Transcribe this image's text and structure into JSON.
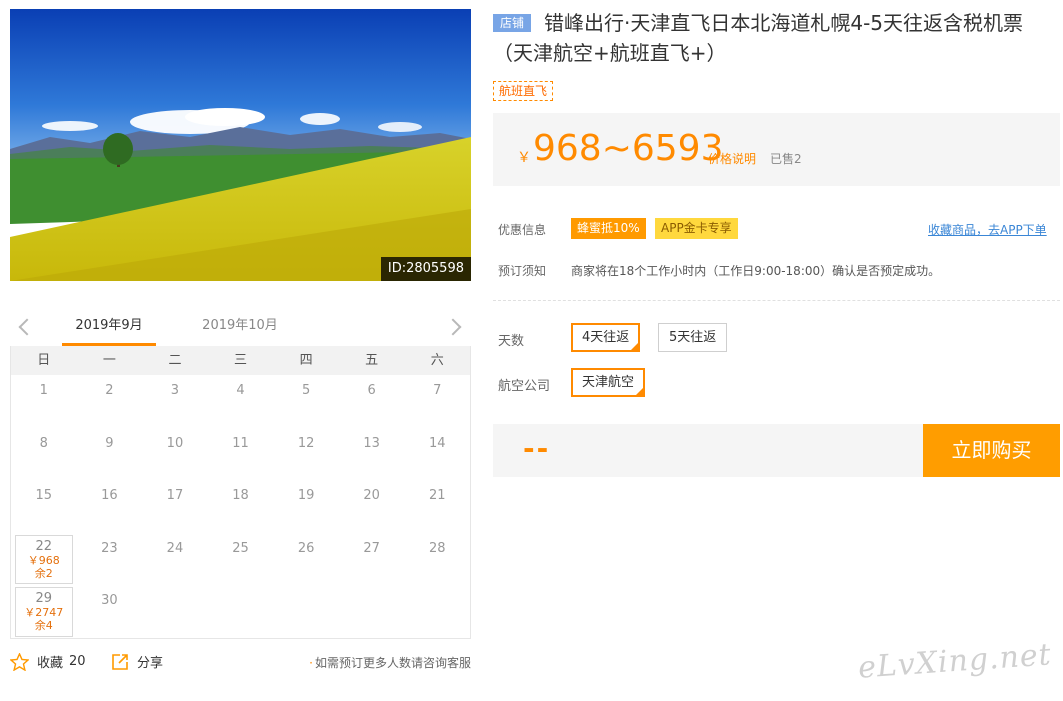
{
  "image": {
    "id_label": "ID:2805598"
  },
  "calendar": {
    "tabs": [
      "2019年9月",
      "2019年10月"
    ],
    "weekdays": [
      "日",
      "一",
      "二",
      "三",
      "四",
      "五",
      "六"
    ],
    "weeks": [
      [
        {
          "day": "1"
        },
        {
          "day": "2"
        },
        {
          "day": "3"
        },
        {
          "day": "4"
        },
        {
          "day": "5"
        },
        {
          "day": "6"
        },
        {
          "day": "7"
        }
      ],
      [
        {
          "day": "8"
        },
        {
          "day": "9"
        },
        {
          "day": "10"
        },
        {
          "day": "11"
        },
        {
          "day": "12"
        },
        {
          "day": "13"
        },
        {
          "day": "14"
        }
      ],
      [
        {
          "day": "15"
        },
        {
          "day": "16"
        },
        {
          "day": "17"
        },
        {
          "day": "18"
        },
        {
          "day": "19"
        },
        {
          "day": "20"
        },
        {
          "day": "21"
        }
      ],
      [
        {
          "day": "22",
          "price": "￥968",
          "stock": "余2"
        },
        {
          "day": "23"
        },
        {
          "day": "24"
        },
        {
          "day": "25"
        },
        {
          "day": "26"
        },
        {
          "day": "27"
        },
        {
          "day": "28"
        }
      ],
      [
        {
          "day": "29",
          "price": "￥2747",
          "stock": "余4"
        },
        {
          "day": "30"
        },
        {
          "day": ""
        },
        {
          "day": ""
        },
        {
          "day": ""
        },
        {
          "day": ""
        },
        {
          "day": ""
        }
      ]
    ]
  },
  "actions": {
    "favorite_label": "收藏",
    "favorite_count": "20",
    "share_label": "分享",
    "tip": "如需预订更多人数请咨询客服"
  },
  "product": {
    "shop_badge": "店铺",
    "title": "错峰出行·天津直飞日本北海道札幌4-5天往返含税机票（天津航空+航班直飞+）",
    "tag": "航班直飞",
    "price_symbol": "￥",
    "price_range": "968~6593",
    "price_note": "价格说明",
    "sold": "已售2"
  },
  "info": {
    "promo_label": "优惠信息",
    "coupons": [
      "蜂蜜抵10%",
      "APP金卡专享"
    ],
    "app_link": "收藏商品，去APP下单",
    "notice_label": "预订须知",
    "notice": "商家将在18个工作小时内（工作日9:00-18:00）确认是否预定成功。"
  },
  "options": {
    "days_label": "天数",
    "days": [
      "4天往返",
      "5天往返"
    ],
    "airline_label": "航空公司",
    "airlines": [
      "天津航空"
    ]
  },
  "purchase": {
    "total": "--",
    "buy_label": "立即购买"
  },
  "watermark": "eLvXing.net",
  "colors": {
    "accent": "#ff8a00",
    "buy_button": "#ff9d00",
    "shop_badge": "#78a5e6",
    "link": "#3a86d6"
  }
}
